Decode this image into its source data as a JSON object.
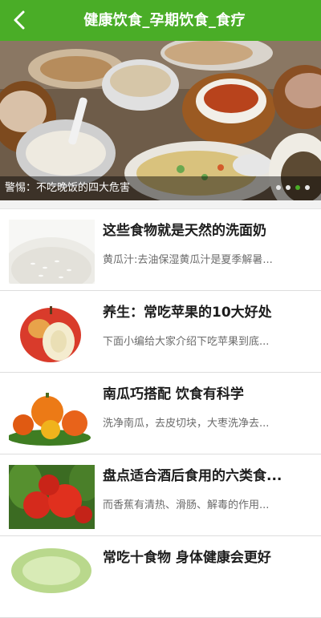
{
  "header": {
    "title": "健康饮食_孕期饮食_食疗",
    "background": "#4aad27",
    "back_icon": "chevron-left-icon"
  },
  "banner": {
    "caption": "警惕：不吃晚饭的四大危害",
    "slide_count": 4,
    "active_slide": 3
  },
  "articles": [
    {
      "title": "这些食物就是天然的洗面奶",
      "desc": "黄瓜汁:去油保湿黄瓜汁是夏季解暑...",
      "thumb": "rice-image"
    },
    {
      "title": "养生：常吃苹果的10大好处",
      "desc": "下面小编给大家介绍下吃苹果到底...",
      "thumb": "apple-image"
    },
    {
      "title": "南瓜巧搭配 饮食有科学",
      "desc": "洗净南瓜，去皮切块，大枣洗净去...",
      "thumb": "pumpkin-image"
    },
    {
      "title": "盘点适合酒后食用的六类食...",
      "desc": "而香蕉有清热、滑肠、解毒的作用...",
      "thumb": "tomato-image"
    },
    {
      "title": "常吃十食物 身体健康会更好",
      "desc": "",
      "thumb": "cabbage-image"
    }
  ]
}
